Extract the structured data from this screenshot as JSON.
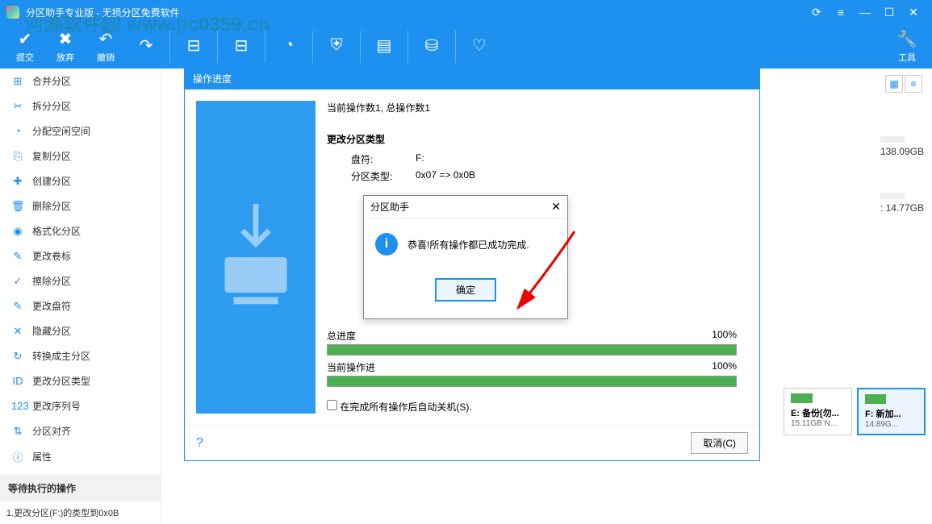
{
  "title": "分区助手专业版 - 无损分区免费软件",
  "watermark": "河源软件园\nwww.pc0359.cn",
  "toolbar": {
    "submit": "提交",
    "discard": "放弃",
    "undo": "撤销",
    "redo": "",
    "t1": "",
    "t2": "",
    "t3": "",
    "t4": "",
    "t5": "",
    "t6": "",
    "t7": "",
    "t8": "",
    "tools": "工具"
  },
  "sidebar": {
    "items": [
      {
        "icon": "⊞",
        "label": "合并分区"
      },
      {
        "icon": "✂",
        "label": "拆分分区"
      },
      {
        "icon": "◔",
        "label": "分配空闲空间"
      },
      {
        "icon": "⎘",
        "label": "复制分区"
      },
      {
        "icon": "✚",
        "label": "创建分区"
      },
      {
        "icon": "🗑",
        "label": "删除分区"
      },
      {
        "icon": "◉",
        "label": "格式化分区"
      },
      {
        "icon": "✎",
        "label": "更改卷标"
      },
      {
        "icon": "✓",
        "label": "擦除分区"
      },
      {
        "icon": "✎",
        "label": "更改盘符"
      },
      {
        "icon": "✕",
        "label": "隐藏分区"
      },
      {
        "icon": "↻",
        "label": "转换成主分区"
      },
      {
        "icon": "ID",
        "label": "更改分区类型"
      },
      {
        "icon": "123",
        "label": "更改序列号"
      },
      {
        "icon": "⇅",
        "label": "分区对齐"
      },
      {
        "icon": "ⓘ",
        "label": "属性"
      }
    ],
    "pending_head": "等待执行的操作",
    "pending_item": "1.更改分区(F:)的类型到0x0B"
  },
  "disks": {
    "d1_size": "138.09GB",
    "d2_size": ": 14.77GB"
  },
  "parts": [
    {
      "name": "E: 备份[勿...",
      "size": "15.11GB N..."
    },
    {
      "name": "F: 新加...",
      "size": "14.89G..."
    }
  ],
  "progress": {
    "title": "操作进度",
    "current_ops": "当前操作数1, 总操作数1",
    "op_title": "更改分区类型",
    "drive_k": "盘符:",
    "drive_v": "F:",
    "type_k": "分区类型:",
    "type_v": "0x07 => 0x0B",
    "total_label": "总进度",
    "total_pct": "100%",
    "cur_label": "当前操作进",
    "cur_pct": "100%",
    "shutdown": "在完成所有操作后自动关机(S).",
    "cancel": "取消(C)"
  },
  "msg": {
    "title": "分区助手",
    "text": "恭喜!所有操作都已成功完成.",
    "ok": "确定"
  }
}
